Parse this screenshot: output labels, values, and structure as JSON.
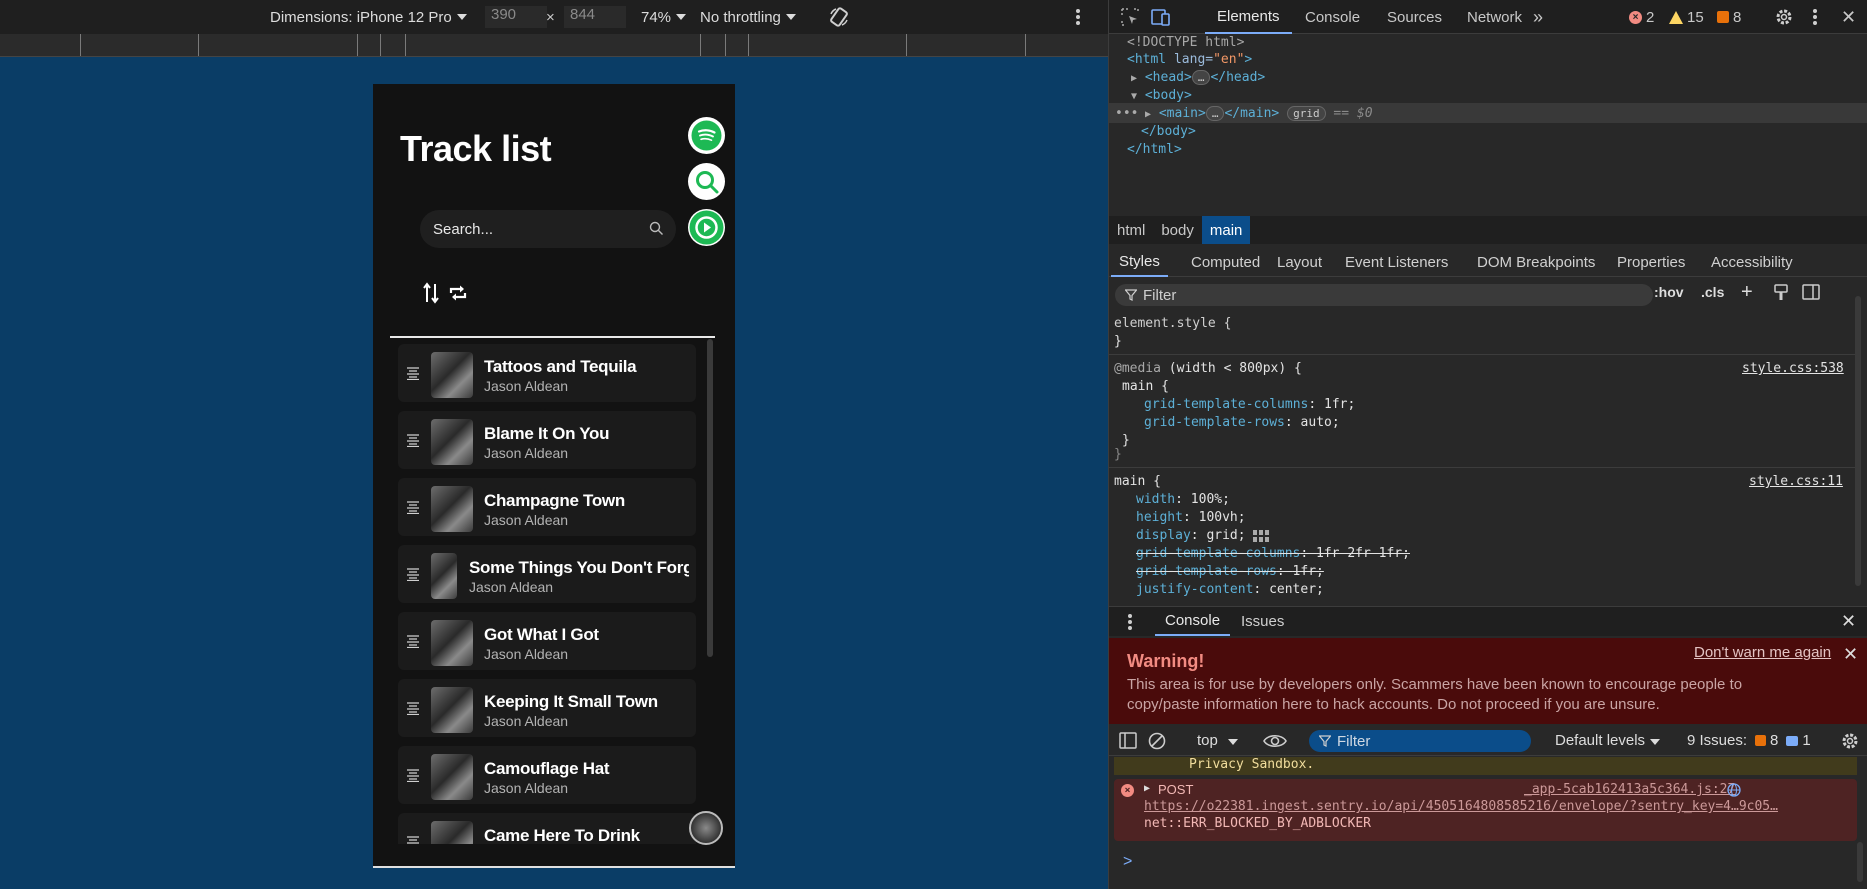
{
  "device_toolbar": {
    "dimensions_label": "Dimensions: iPhone 12 Pro",
    "width": "390",
    "height": "844",
    "times": "×",
    "zoom": "74%",
    "throttling": "No throttling"
  },
  "app": {
    "title": "Track list",
    "search_placeholder": "Search...",
    "tracks": [
      {
        "name": "Tattoos and Tequila",
        "artist": "Jason Aldean"
      },
      {
        "name": "Blame It On You",
        "artist": "Jason Aldean"
      },
      {
        "name": "Champagne Town",
        "artist": "Jason Aldean"
      },
      {
        "name": "Some Things You Don't Forg",
        "artist": "Jason Aldean"
      },
      {
        "name": "Got What I Got",
        "artist": "Jason Aldean"
      },
      {
        "name": "Keeping It Small Town",
        "artist": "Jason Aldean"
      },
      {
        "name": "Camouflage Hat",
        "artist": "Jason Aldean"
      },
      {
        "name": "Came Here To Drink",
        "artist": ""
      }
    ],
    "accent": "#1db954"
  },
  "devtools": {
    "tabs": [
      "Elements",
      "Console",
      "Sources",
      "Network"
    ],
    "more_tabs": "»",
    "errors": "2",
    "warnings": "15",
    "issues": "8",
    "dom": {
      "doctype": "<!DOCTYPE html>",
      "html_open_tag": "<html",
      "lang_attr": "lang=",
      "lang_val": "\"en\"",
      "head_open": "<head>",
      "head_close": "</head>",
      "body_open": "<body>",
      "main_open": "<main>",
      "main_close": "</main>",
      "grid_badge": "grid",
      "selected_ref": "== $0",
      "body_close": "</body>",
      "html_close": "</html>",
      "ellipsis": "…",
      "row_dots": "•••",
      "gt": ">"
    },
    "breadcrumbs": [
      "html",
      "body",
      "main"
    ],
    "sub_tabs": [
      "Styles",
      "Computed",
      "Layout",
      "Event Listeners",
      "DOM Breakpoints",
      "Properties",
      "Accessibility"
    ],
    "filter_placeholder": "Filter",
    "hov": ":hov",
    "cls": ".cls",
    "styles": {
      "element_style": "element.style {",
      "close_brace": "}",
      "media_rule": "@media",
      "media_cond": "(width < 800px) {",
      "main_selector": "main {",
      "source_1": "style.css:538",
      "source_2": "style.css:11",
      "decls_media": [
        {
          "prop": "grid-template-columns",
          "val": "1fr;"
        },
        {
          "prop": "grid-template-rows",
          "val": "auto;"
        }
      ],
      "decls_main": [
        {
          "prop": "width",
          "val": "100%;"
        },
        {
          "prop": "height",
          "val": "100vh;"
        },
        {
          "prop": "display",
          "val": "grid;"
        },
        {
          "prop": "grid-template-columns",
          "val": "1fr 2fr 1fr;"
        },
        {
          "prop": "grid-template-rows",
          "val": "1fr;"
        },
        {
          "prop": "justify-content",
          "val": "center;"
        }
      ]
    },
    "console": {
      "tabs": [
        "Console",
        "Issues"
      ],
      "warning_title": "Warning!",
      "warning_body": "This area is for use by developers only. Scammers have been known to encourage people to copy/paste information here to hack accounts. Do not proceed if you are unsure.",
      "dont_warn": "Don't warn me again",
      "context": "top",
      "filter_placeholder": "Filter",
      "levels": "Default levels",
      "issues_label": "9 Issues:",
      "issues_warn": "8",
      "issues_info": "1",
      "sandbox_msg": "Privacy Sandbox.",
      "error_method": "POST",
      "error_source": "_app-5cab162413a5c364.js:27",
      "error_url": "https://o22381.ingest.sentry.io/api/4505164808585216/envelope/?sentry_key=4…9c05…",
      "error_msg": "net::ERR_BLOCKED_BY_ADBLOCKER",
      "prompt": ">"
    }
  }
}
